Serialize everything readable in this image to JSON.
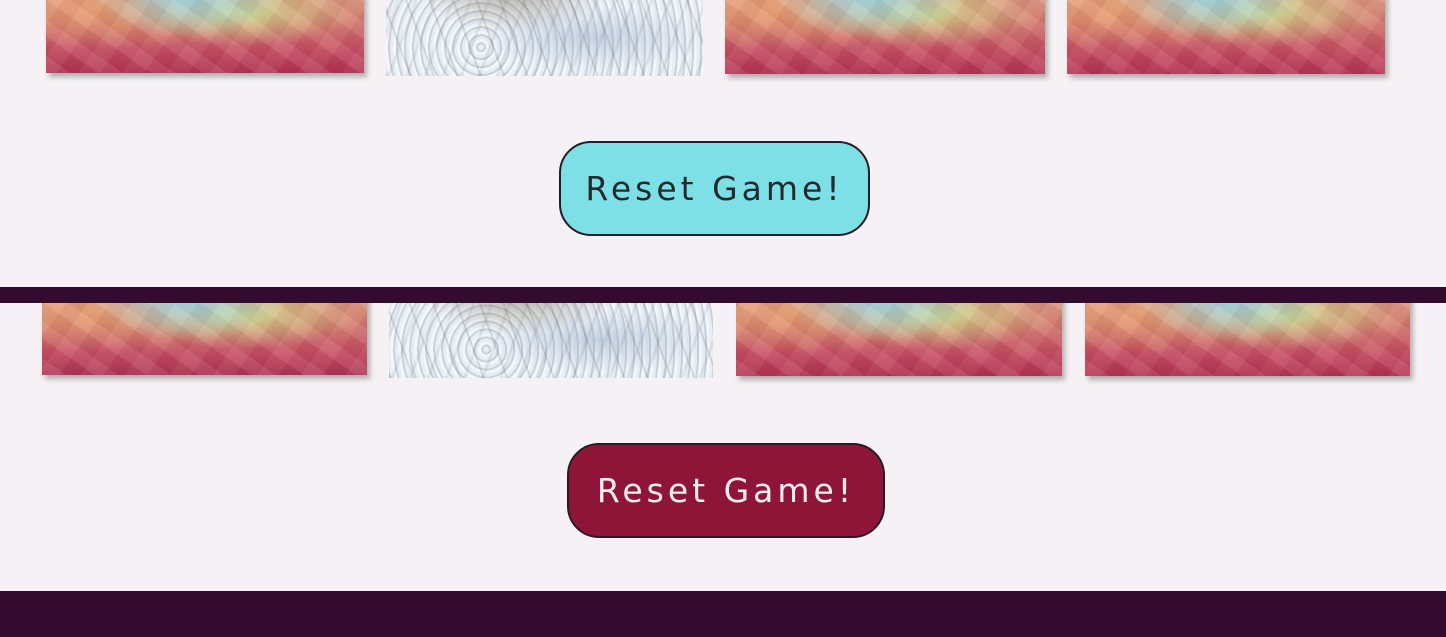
{
  "colors": {
    "background": "#f6f1f4",
    "divider": "#330b2f",
    "reset_primary": "#7de0e6",
    "reset_hover": "#8e1438"
  },
  "panels": [
    {
      "cards": [
        {
          "state": "face-down"
        },
        {
          "state": "face-up",
          "image": "snow-image"
        },
        {
          "state": "face-down"
        },
        {
          "state": "face-down"
        }
      ],
      "reset_label": "Reset Game!"
    },
    {
      "cards": [
        {
          "state": "face-down"
        },
        {
          "state": "face-up",
          "image": "snow-image"
        },
        {
          "state": "face-down"
        },
        {
          "state": "face-down"
        }
      ],
      "reset_label": "Reset Game!"
    }
  ]
}
